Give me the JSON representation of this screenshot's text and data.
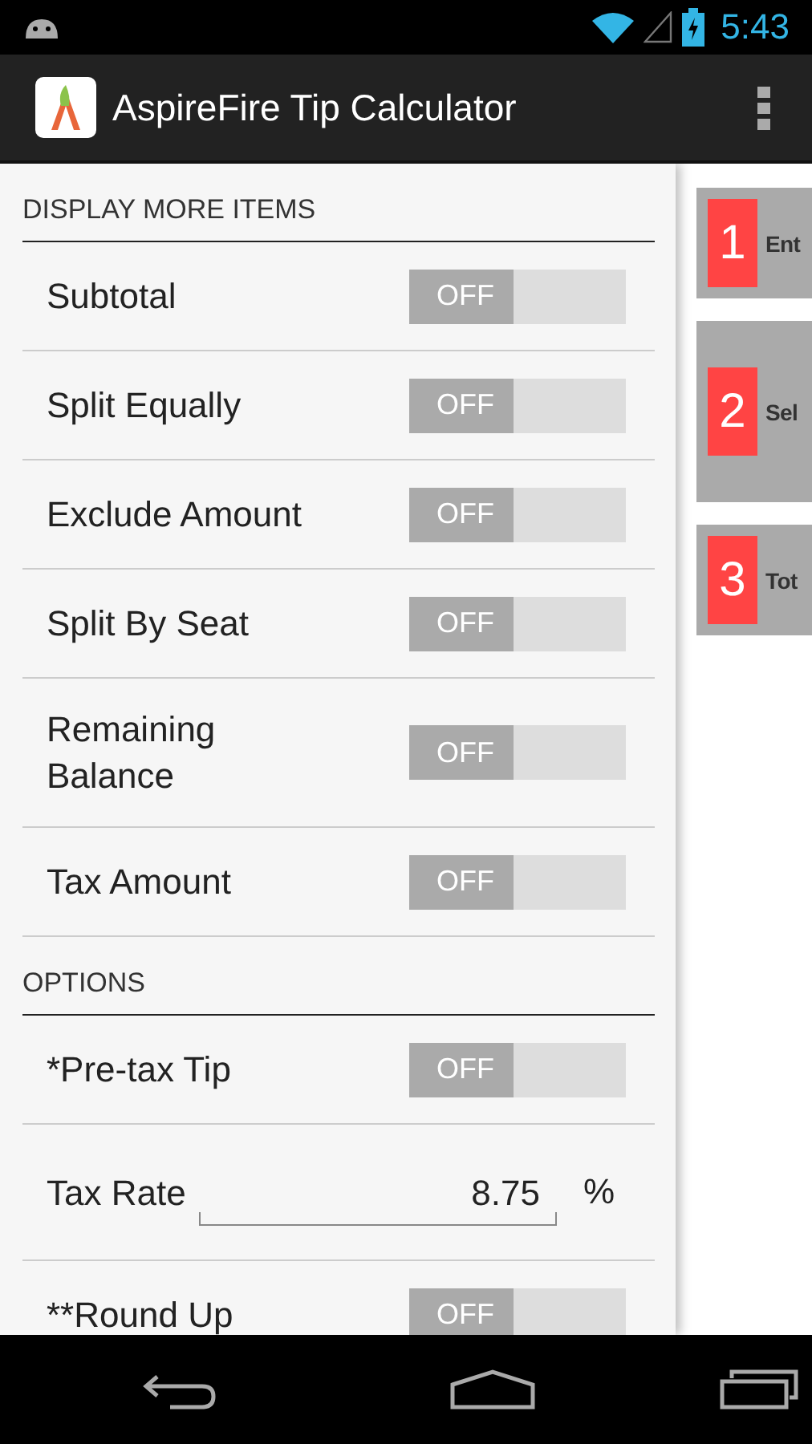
{
  "status_bar": {
    "time": "5:43"
  },
  "app_bar": {
    "title": "AspireFire Tip Calculator"
  },
  "sections": [
    {
      "heading": "DISPLAY MORE ITEMS",
      "rows": [
        {
          "kind": "switch",
          "label": "Subtotal",
          "switch_text": "OFF",
          "on": false
        },
        {
          "kind": "switch",
          "label": "Split Equally",
          "switch_text": "OFF",
          "on": false
        },
        {
          "kind": "switch",
          "label": "Exclude Amount",
          "switch_text": "OFF",
          "on": false
        },
        {
          "kind": "switch",
          "label": "Split By Seat",
          "switch_text": "OFF",
          "on": false
        },
        {
          "kind": "switch",
          "label": "Remaining Balance",
          "switch_text": "OFF",
          "on": false
        },
        {
          "kind": "switch",
          "label": "Tax Amount",
          "switch_text": "OFF",
          "on": false
        }
      ]
    },
    {
      "heading": "OPTIONS",
      "rows": [
        {
          "kind": "switch",
          "label": "*Pre-tax Tip",
          "switch_text": "OFF",
          "on": false
        },
        {
          "kind": "field",
          "label": "Tax Rate",
          "value": "8.75",
          "unit": "%"
        },
        {
          "kind": "switch",
          "label": "**Round Up",
          "switch_text": "OFF",
          "on": false
        }
      ]
    }
  ],
  "steps": [
    {
      "number": "1",
      "text": "Ent"
    },
    {
      "number": "2",
      "text": "Sel"
    },
    {
      "number": "3",
      "text": "Tot"
    }
  ]
}
